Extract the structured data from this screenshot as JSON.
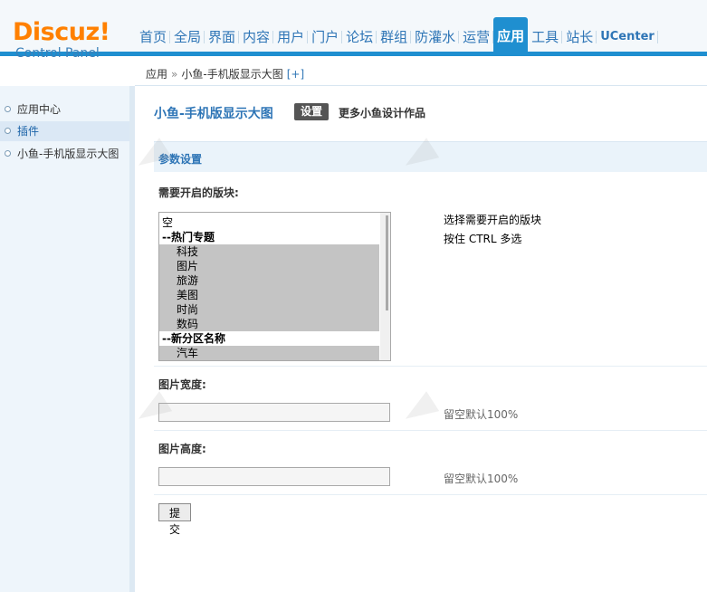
{
  "logo": {
    "main": "Discuz!",
    "sub": "Control Panel"
  },
  "nav": {
    "items": [
      "首页",
      "全局",
      "界面",
      "内容",
      "用户",
      "门户",
      "论坛",
      "群组",
      "防灌水",
      "运营",
      "应用",
      "工具",
      "站长",
      "UCenter"
    ],
    "active": "应用"
  },
  "breadcrumb": {
    "root": "应用",
    "separator": "»",
    "current": "小鱼-手机版显示大图",
    "add": "[+]"
  },
  "sidebar": {
    "items": [
      {
        "label": "应用中心"
      },
      {
        "label": "插件"
      },
      {
        "label": "小鱼-手机版显示大图"
      }
    ],
    "active_index": 1
  },
  "main": {
    "title": "小鱼-手机版显示大图",
    "tab_settings": "设置",
    "more_link": "更多小鱼设计作品",
    "section_title": "参数设置",
    "blocks": {
      "label": "需要开启的版块:",
      "options": [
        {
          "text": "空"
        },
        {
          "text": "--热门专题"
        },
        {
          "text": "科技"
        },
        {
          "text": "图片"
        },
        {
          "text": "旅游"
        },
        {
          "text": "美图"
        },
        {
          "text": "时尚"
        },
        {
          "text": "数码"
        },
        {
          "text": "--新分区名称"
        },
        {
          "text": "汽车"
        }
      ],
      "help_line1": "选择需要开启的版块",
      "help_line2": "按住 CTRL 多选"
    },
    "width": {
      "label": "图片宽度:",
      "value": "",
      "help": "留空默认100%"
    },
    "height": {
      "label": "图片高度:",
      "value": "",
      "help": "留空默认100%"
    },
    "submit_label": "提交"
  },
  "colors": {
    "accent": "#1f8fd0",
    "logo": "#ff8000",
    "link": "#2e75b6",
    "selected_option": "#c4c4c4"
  }
}
